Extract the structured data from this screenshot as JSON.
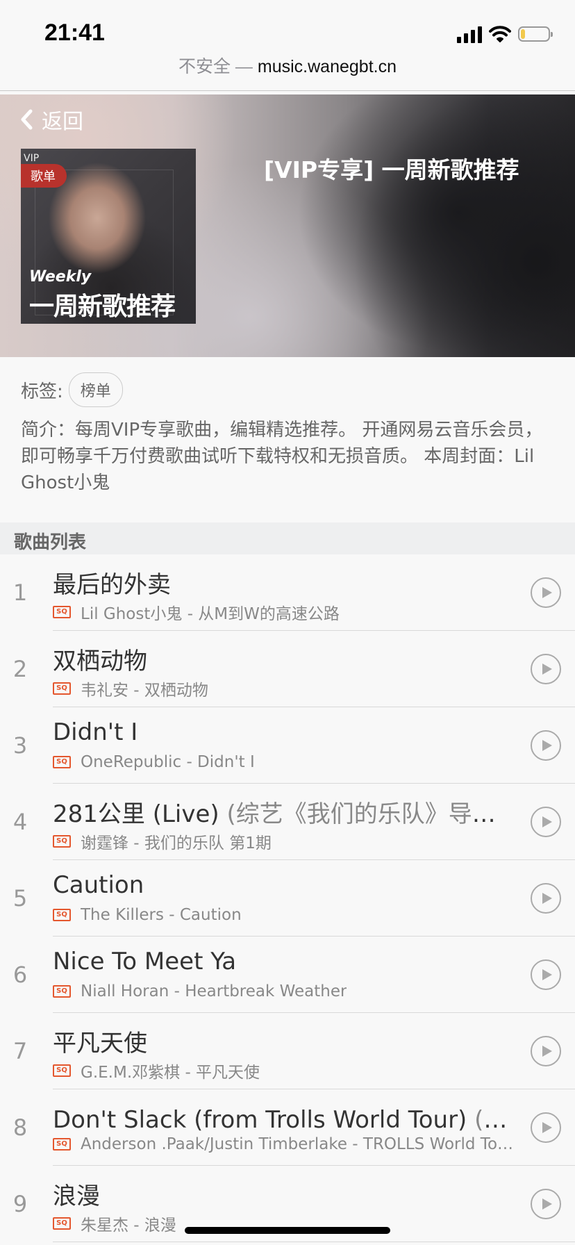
{
  "status_bar": {
    "time": "21:41",
    "url_insecure": "不安全 — ",
    "url_host": "music.wanegbt.cn",
    "icons": [
      "cellular-signal-icon",
      "wifi-icon",
      "battery-icon"
    ],
    "battery_level": 0.15
  },
  "header": {
    "back_label": "返回",
    "playlist_title": "[VIP专享] 一周新歌推荐",
    "cover": {
      "vip_text": "VIP",
      "badge": "歌单",
      "weekly_text": "Weekly",
      "title_text": "一周新歌推荐"
    }
  },
  "info": {
    "tags_label": "标签:",
    "tags": [
      "榜单"
    ],
    "intro": "简介：每周VIP专享歌曲，编辑精选推荐。 开通网易云音乐会员，即可畅享千万付费歌曲试听下载特权和无损音质。 本周封面：Lil Ghost小鬼"
  },
  "song_list": {
    "section_title": "歌曲列表",
    "quality_badge": "SQ",
    "songs": [
      {
        "index": "1",
        "title": "最后的外卖",
        "subtitle": "",
        "artist_album": "Lil Ghost小鬼 - 从M到W的高速公路"
      },
      {
        "index": "2",
        "title": "双栖动物",
        "subtitle": "",
        "artist_album": "韦礼安 - 双栖动物"
      },
      {
        "index": "3",
        "title": "Didn't I",
        "subtitle": "",
        "artist_album": "OneRepublic - Didn't I"
      },
      {
        "index": "4",
        "title": "281公里 (Live)",
        "subtitle": " (综艺《我们的乐队》导师s…",
        "artist_album": "谢霆锋 - 我们的乐队 第1期"
      },
      {
        "index": "5",
        "title": "Caution",
        "subtitle": "",
        "artist_album": "The Killers - Caution"
      },
      {
        "index": "6",
        "title": "Nice To Meet Ya",
        "subtitle": "",
        "artist_album": "Niall Horan - Heartbreak Weather"
      },
      {
        "index": "7",
        "title": "平凡天使",
        "subtitle": "",
        "artist_album": "G.E.M.邓紫棋 - 平凡天使"
      },
      {
        "index": "8",
        "title": "Don't Slack (from Trolls World Tour)",
        "subtitle": " (电影…",
        "artist_album": "Anderson .Paak/Justin Timberlake - TROLLS World Tour…"
      },
      {
        "index": "9",
        "title": "浪漫",
        "subtitle": "",
        "artist_album": "朱星杰 - 浪漫"
      }
    ]
  },
  "colors": {
    "accent_red": "#b8322c",
    "sq_badge": "#e4572e",
    "page_background": "#f8f8f8",
    "section_header_background": "#eeeff0"
  }
}
